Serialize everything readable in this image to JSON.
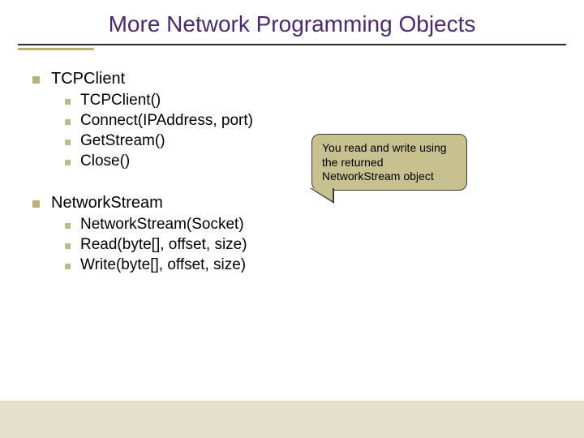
{
  "title": "More Network Programming Objects",
  "list": {
    "item1": {
      "label": "TCPClient"
    },
    "item1sub": {
      "a": "TCPClient()",
      "b": "Connect(IPAddress, port)",
      "c": "GetStream()",
      "d": "Close()"
    },
    "item2": {
      "label": "NetworkStream"
    },
    "item2sub": {
      "a": "NetworkStream(Socket)",
      "b": "Read(byte[], offset, size)",
      "c": "Write(byte[], offset, size)"
    }
  },
  "callout": {
    "text": "You read and write using the returned NetworkStream object"
  }
}
